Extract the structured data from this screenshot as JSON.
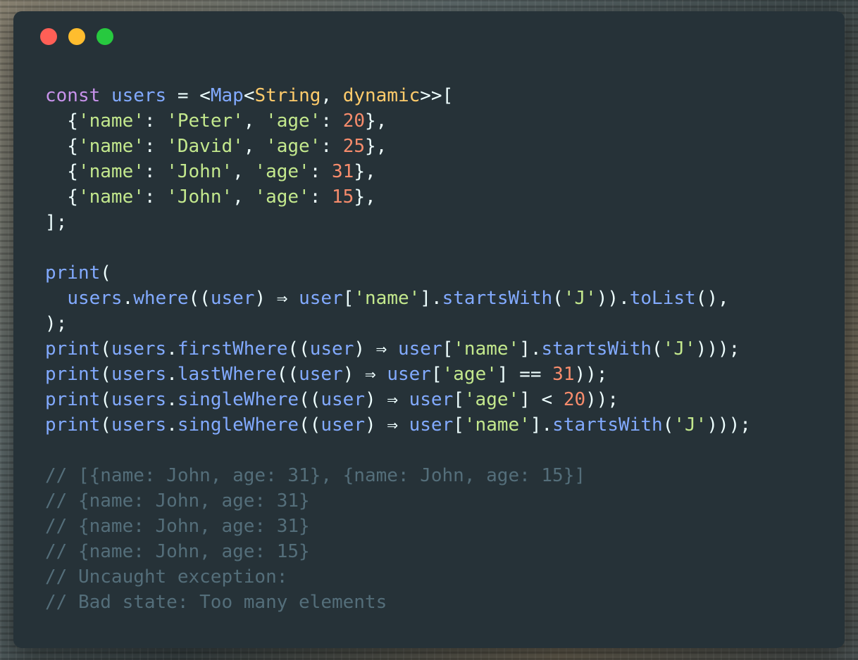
{
  "window": {
    "controls": [
      "close",
      "minimize",
      "maximize"
    ]
  },
  "colors": {
    "background": "#263238",
    "keyword": "#c792ea",
    "variable": "#82aaff",
    "type": "#ffcb6b",
    "string": "#c3e88d",
    "number": "#f78c6c",
    "punctuation": "#eeffff",
    "comment": "#546e7a"
  },
  "code": {
    "lines": [
      [
        [
          "keyword",
          "const"
        ],
        [
          "text",
          " "
        ],
        [
          "var",
          "users"
        ],
        [
          "op",
          " = "
        ],
        [
          "punct",
          "<"
        ],
        [
          "var",
          "Map"
        ],
        [
          "punct",
          "<"
        ],
        [
          "type",
          "String"
        ],
        [
          "punct",
          ", "
        ],
        [
          "type",
          "dynamic"
        ],
        [
          "punct",
          ">>["
        ]
      ],
      [
        [
          "punct",
          "  {"
        ],
        [
          "string",
          "'name'"
        ],
        [
          "punct",
          ": "
        ],
        [
          "string",
          "'Peter'"
        ],
        [
          "punct",
          ", "
        ],
        [
          "string",
          "'age'"
        ],
        [
          "punct",
          ": "
        ],
        [
          "number",
          "20"
        ],
        [
          "punct",
          "},"
        ]
      ],
      [
        [
          "punct",
          "  {"
        ],
        [
          "string",
          "'name'"
        ],
        [
          "punct",
          ": "
        ],
        [
          "string",
          "'David'"
        ],
        [
          "punct",
          ", "
        ],
        [
          "string",
          "'age'"
        ],
        [
          "punct",
          ": "
        ],
        [
          "number",
          "25"
        ],
        [
          "punct",
          "},"
        ]
      ],
      [
        [
          "punct",
          "  {"
        ],
        [
          "string",
          "'name'"
        ],
        [
          "punct",
          ": "
        ],
        [
          "string",
          "'John'"
        ],
        [
          "punct",
          ", "
        ],
        [
          "string",
          "'age'"
        ],
        [
          "punct",
          ": "
        ],
        [
          "number",
          "31"
        ],
        [
          "punct",
          "},"
        ]
      ],
      [
        [
          "punct",
          "  {"
        ],
        [
          "string",
          "'name'"
        ],
        [
          "punct",
          ": "
        ],
        [
          "string",
          "'John'"
        ],
        [
          "punct",
          ", "
        ],
        [
          "string",
          "'age'"
        ],
        [
          "punct",
          ": "
        ],
        [
          "number",
          "15"
        ],
        [
          "punct",
          "},"
        ]
      ],
      [
        [
          "punct",
          "];"
        ]
      ],
      [],
      [
        [
          "var",
          "print"
        ],
        [
          "punct",
          "("
        ]
      ],
      [
        [
          "text",
          "  "
        ],
        [
          "var",
          "users"
        ],
        [
          "punct",
          "."
        ],
        [
          "var",
          "where"
        ],
        [
          "punct",
          "(("
        ],
        [
          "var",
          "user"
        ],
        [
          "punct",
          ") "
        ],
        [
          "op",
          "⇒"
        ],
        [
          "text",
          " "
        ],
        [
          "var",
          "user"
        ],
        [
          "punct",
          "["
        ],
        [
          "string",
          "'name'"
        ],
        [
          "punct",
          "]."
        ],
        [
          "var",
          "startsWith"
        ],
        [
          "punct",
          "("
        ],
        [
          "string",
          "'J'"
        ],
        [
          "punct",
          "))."
        ],
        [
          "var",
          "toList"
        ],
        [
          "punct",
          "(),"
        ]
      ],
      [
        [
          "punct",
          ");"
        ]
      ],
      [
        [
          "var",
          "print"
        ],
        [
          "punct",
          "("
        ],
        [
          "var",
          "users"
        ],
        [
          "punct",
          "."
        ],
        [
          "var",
          "firstWhere"
        ],
        [
          "punct",
          "(("
        ],
        [
          "var",
          "user"
        ],
        [
          "punct",
          ") "
        ],
        [
          "op",
          "⇒"
        ],
        [
          "text",
          " "
        ],
        [
          "var",
          "user"
        ],
        [
          "punct",
          "["
        ],
        [
          "string",
          "'name'"
        ],
        [
          "punct",
          "]."
        ],
        [
          "var",
          "startsWith"
        ],
        [
          "punct",
          "("
        ],
        [
          "string",
          "'J'"
        ],
        [
          "punct",
          ")));"
        ]
      ],
      [
        [
          "var",
          "print"
        ],
        [
          "punct",
          "("
        ],
        [
          "var",
          "users"
        ],
        [
          "punct",
          "."
        ],
        [
          "var",
          "lastWhere"
        ],
        [
          "punct",
          "(("
        ],
        [
          "var",
          "user"
        ],
        [
          "punct",
          ") "
        ],
        [
          "op",
          "⇒"
        ],
        [
          "text",
          " "
        ],
        [
          "var",
          "user"
        ],
        [
          "punct",
          "["
        ],
        [
          "string",
          "'age'"
        ],
        [
          "punct",
          "] "
        ],
        [
          "op",
          "=="
        ],
        [
          "text",
          " "
        ],
        [
          "number",
          "31"
        ],
        [
          "punct",
          "));"
        ]
      ],
      [
        [
          "var",
          "print"
        ],
        [
          "punct",
          "("
        ],
        [
          "var",
          "users"
        ],
        [
          "punct",
          "."
        ],
        [
          "var",
          "singleWhere"
        ],
        [
          "punct",
          "(("
        ],
        [
          "var",
          "user"
        ],
        [
          "punct",
          ") "
        ],
        [
          "op",
          "⇒"
        ],
        [
          "text",
          " "
        ],
        [
          "var",
          "user"
        ],
        [
          "punct",
          "["
        ],
        [
          "string",
          "'age'"
        ],
        [
          "punct",
          "] "
        ],
        [
          "op",
          "<"
        ],
        [
          "text",
          " "
        ],
        [
          "number",
          "20"
        ],
        [
          "punct",
          "));"
        ]
      ],
      [
        [
          "var",
          "print"
        ],
        [
          "punct",
          "("
        ],
        [
          "var",
          "users"
        ],
        [
          "punct",
          "."
        ],
        [
          "var",
          "singleWhere"
        ],
        [
          "punct",
          "(("
        ],
        [
          "var",
          "user"
        ],
        [
          "punct",
          ") "
        ],
        [
          "op",
          "⇒"
        ],
        [
          "text",
          " "
        ],
        [
          "var",
          "user"
        ],
        [
          "punct",
          "["
        ],
        [
          "string",
          "'name'"
        ],
        [
          "punct",
          "]."
        ],
        [
          "var",
          "startsWith"
        ],
        [
          "punct",
          "("
        ],
        [
          "string",
          "'J'"
        ],
        [
          "punct",
          ")));"
        ]
      ],
      [],
      [
        [
          "comment",
          "// [{name: John, age: 31}, {name: John, age: 15}]"
        ]
      ],
      [
        [
          "comment",
          "// {name: John, age: 31}"
        ]
      ],
      [
        [
          "comment",
          "// {name: John, age: 31}"
        ]
      ],
      [
        [
          "comment",
          "// {name: John, age: 15}"
        ]
      ],
      [
        [
          "comment",
          "// Uncaught exception:"
        ]
      ],
      [
        [
          "comment",
          "// Bad state: Too many elements"
        ]
      ]
    ]
  }
}
